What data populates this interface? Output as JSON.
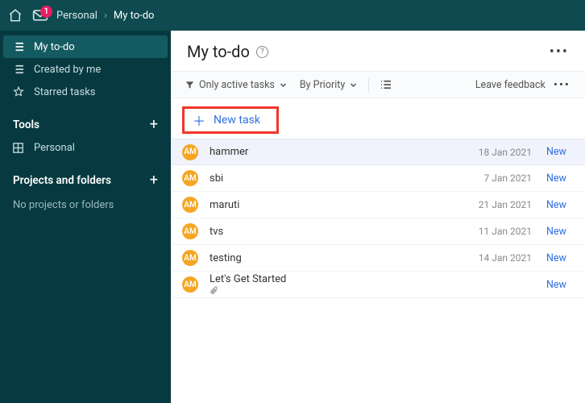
{
  "topbar": {
    "mail_badge": "1",
    "workspace": "Personal",
    "page": "My to-do"
  },
  "sidebar": {
    "nav": [
      {
        "label": "My to-do",
        "active": true
      },
      {
        "label": "Created by me",
        "active": false
      },
      {
        "label": "Starred tasks",
        "active": false
      }
    ],
    "tools_header": "Tools",
    "tools_items": [
      {
        "label": "Personal"
      }
    ],
    "projects_header": "Projects and folders",
    "projects_empty": "No projects or folders"
  },
  "main": {
    "title": "My to-do",
    "filter_active": "Only active tasks",
    "filter_priority": "By Priority",
    "feedback": "Leave feedback",
    "new_task": "New task",
    "avatar_initials": "AM",
    "status_new": "New",
    "tasks": [
      {
        "title": "hammer",
        "date": "18 Jan 2021",
        "highlight": true,
        "attachment": false
      },
      {
        "title": "sbi",
        "date": "7 Jan 2021",
        "highlight": false,
        "attachment": false
      },
      {
        "title": "maruti",
        "date": "21 Jan 2021",
        "highlight": false,
        "attachment": false
      },
      {
        "title": "tvs",
        "date": "11 Jan 2021",
        "highlight": false,
        "attachment": false
      },
      {
        "title": "testing",
        "date": "14 Jan 2021",
        "highlight": false,
        "attachment": false
      },
      {
        "title": "Let's Get Started",
        "date": "",
        "highlight": false,
        "attachment": true
      }
    ]
  }
}
